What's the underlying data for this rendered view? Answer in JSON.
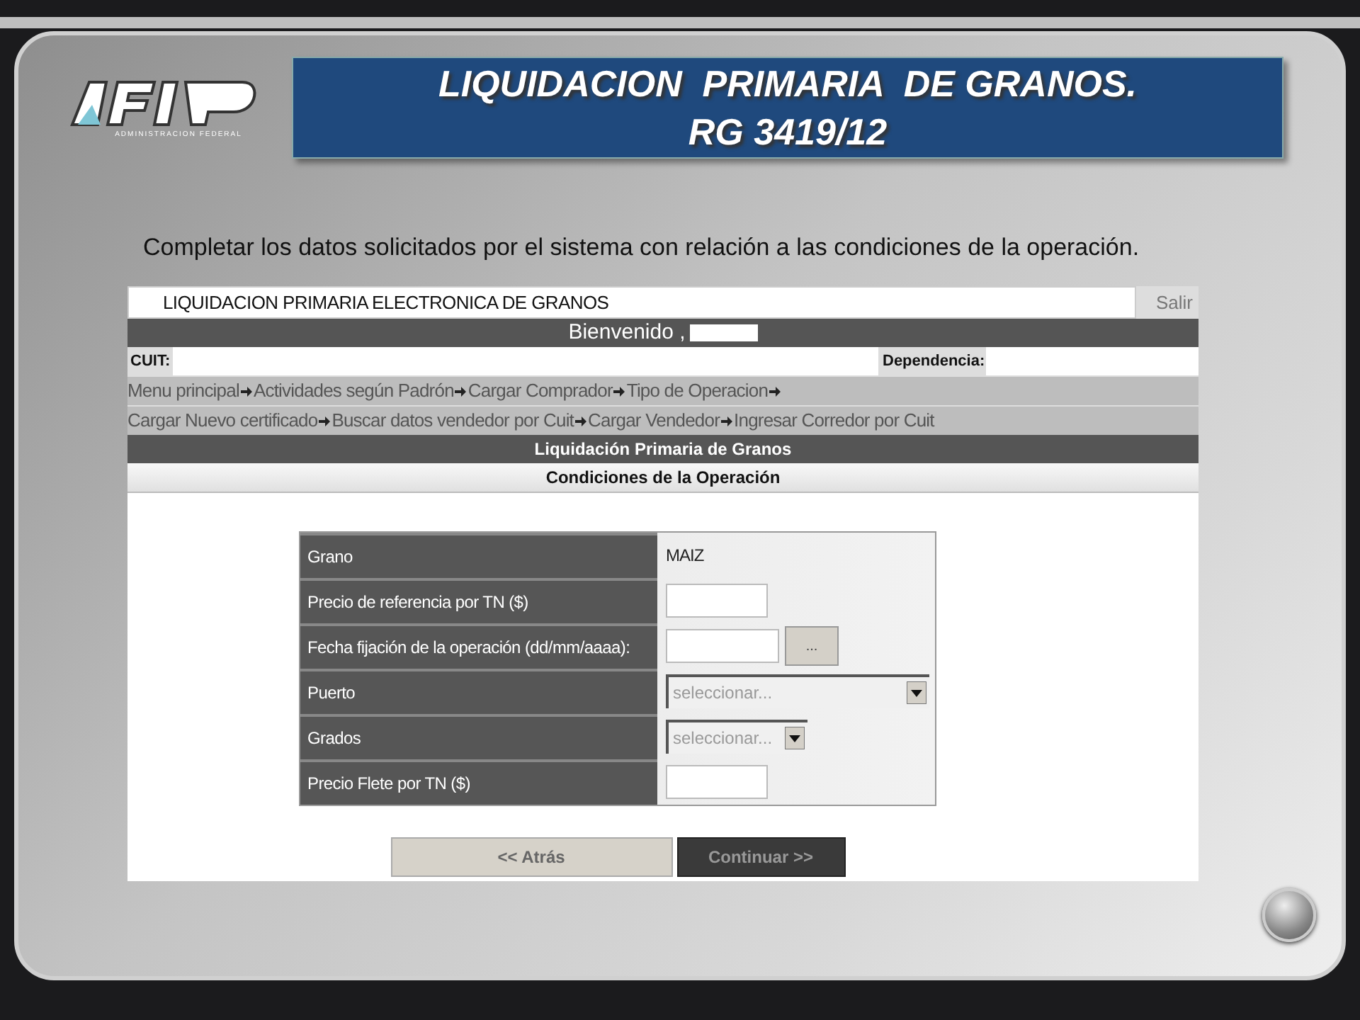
{
  "slide": {
    "logo_caption": "ADMINISTRACION FEDERAL",
    "title_lines": [
      "LIQUIDACION  PRIMARIA  DE GRANOS.",
      "RG 3419/12"
    ],
    "instruction": "Completar los datos solicitados por el sistema con relación a las condiciones de la operación."
  },
  "app": {
    "title": "LIQUIDACION PRIMARIA ELECTRONICA DE GRANOS",
    "exit_button": "Salir",
    "welcome": "Bienvenido ,",
    "cuit_label": "CUIT:",
    "dependencia_label": "Dependencia:",
    "breadcrumbs": [
      [
        "Menu principal",
        "Actividades según Padrón",
        "Cargar Comprador",
        "Tipo de Operacion"
      ],
      [
        "Cargar Nuevo certificado",
        "Buscar datos vendedor por Cuit",
        "Cargar Vendedor",
        "Ingresar Corredor por Cuit"
      ]
    ],
    "section_title": "Liquidación Primaria de Granos",
    "subsection_title": "Condiciones de la Operación",
    "form": [
      {
        "label": "Grano",
        "kind": "text",
        "value": "MAIZ"
      },
      {
        "label": "Precio de referencia por TN ($)",
        "kind": "input"
      },
      {
        "label": "Fecha fijación de la operación (dd/mm/aaaa):",
        "kind": "date",
        "button": "..."
      },
      {
        "label": "Puerto",
        "kind": "select",
        "value": "seleccionar...",
        "wide": true
      },
      {
        "label": "Grados",
        "kind": "select",
        "value": "seleccionar...",
        "wide": false
      },
      {
        "label": "Precio Flete por TN ($)",
        "kind": "input"
      }
    ],
    "buttons": [
      {
        "label": "<< Atrás",
        "primary": false
      },
      {
        "label": "Continuar >>",
        "primary": true
      }
    ]
  }
}
